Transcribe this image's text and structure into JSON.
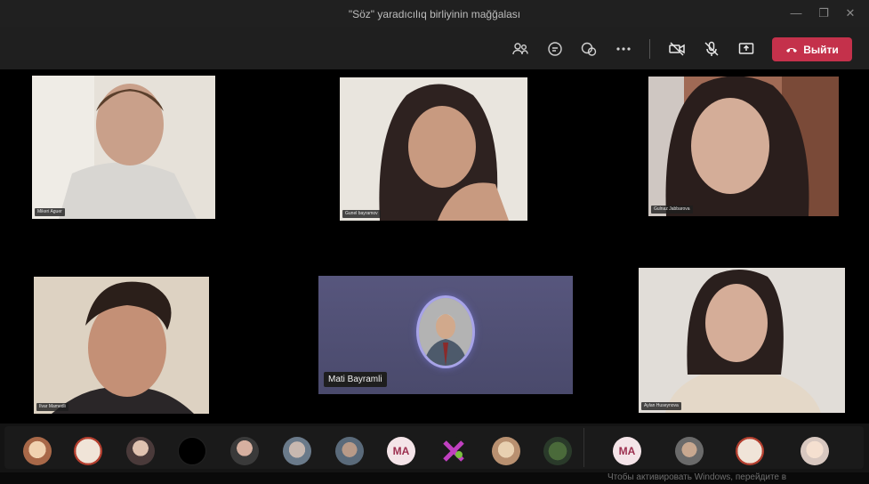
{
  "window": {
    "title": "\"Söz\" yaradıcılıq birliyinin mağğalası",
    "minimize_label": "—",
    "maximize_label": "❐",
    "close_label": "✕"
  },
  "toolbar": {
    "leave_label": "Выйти",
    "icons": [
      "people-icon",
      "chat-icon",
      "reactions-icon",
      "more-icon",
      "camera-off-icon",
      "mic-off-icon",
      "share-icon"
    ]
  },
  "participants": {
    "p1": "Mikeri Aguer",
    "p2": "Gunel bayramov",
    "p3": "Gulnaz Jabbarova",
    "p4": "Ilvar Mamedli",
    "p5": "Mati Bayramli",
    "p6": "Aylan Huseynova"
  },
  "strip": {
    "ma_1": "MA",
    "ma_2": "MA"
  },
  "overlay_text": "Чтобы активировать Windows, перейдите в",
  "colors": {
    "leave": "#c4314b",
    "avatar_ring": "#a7a3e8"
  }
}
